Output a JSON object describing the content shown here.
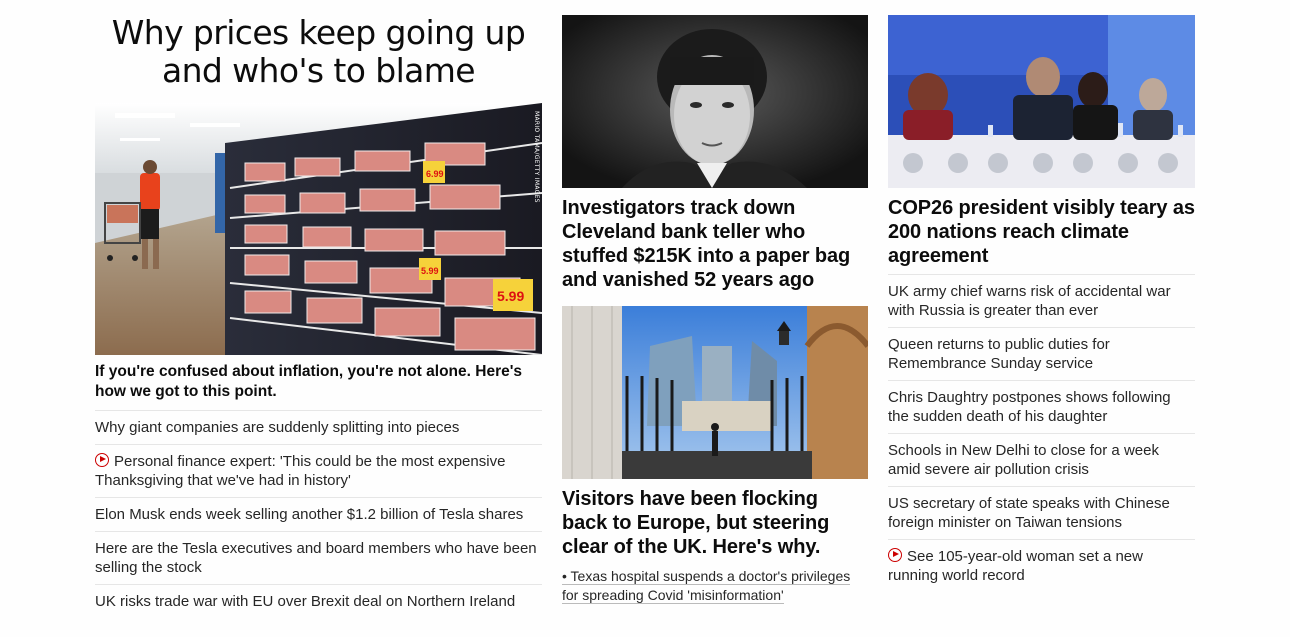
{
  "left": {
    "title": "Why prices keep going up and who's to blame",
    "image_credit": "MARIO TAMA/GETTY IMAGES",
    "price_tags": [
      "6.99",
      "5.99",
      "5.99"
    ],
    "lead": "If you're confused about inflation, you're not alone. Here's how we got to this point.",
    "items": [
      {
        "text": "Why giant companies are suddenly splitting into pieces",
        "video": false
      },
      {
        "text": "Personal finance expert: 'This could be the most expensive Thanksgiving that we've had in history'",
        "video": true
      },
      {
        "text": "Elon Musk ends week selling another $1.2 billion of Tesla shares",
        "video": false
      },
      {
        "text": "Here are the Tesla executives and board members who have been selling the stock",
        "video": false
      },
      {
        "text": "UK risks trade war with EU over Brexit deal on Northern Ireland",
        "video": false
      }
    ]
  },
  "middle": {
    "headline1": "Investigators track down Cleveland bank teller who stuffed $215K into a paper bag and vanished 52 years ago",
    "headline2": "Visitors have been flocking back to Europe, but steering clear of the UK. Here's why.",
    "sub_link": "• Texas hospital suspends a doctor's privileges for spreading Covid 'misinformation'"
  },
  "right": {
    "headline": "COP26 president visibly teary as 200 nations reach climate agreement",
    "items": [
      {
        "text": "UK army chief warns risk of accidental war with Russia is greater than ever",
        "video": false
      },
      {
        "text": "Queen returns to public duties for Remembrance Sunday service",
        "video": false
      },
      {
        "text": "Chris Daughtry postpones shows following the sudden death of his daughter",
        "video": false
      },
      {
        "text": "Schools in New Delhi to close for a week amid severe air pollution crisis",
        "video": false
      },
      {
        "text": "US secretary of state speaks with Chinese foreign minister on Taiwan tensions",
        "video": false
      },
      {
        "text": "See 105-year-old woman set a new running world record",
        "video": true
      }
    ]
  },
  "colors": {
    "accent": "#cc0000",
    "text": "#0c0c0c",
    "divider": "#e6e6e6"
  }
}
